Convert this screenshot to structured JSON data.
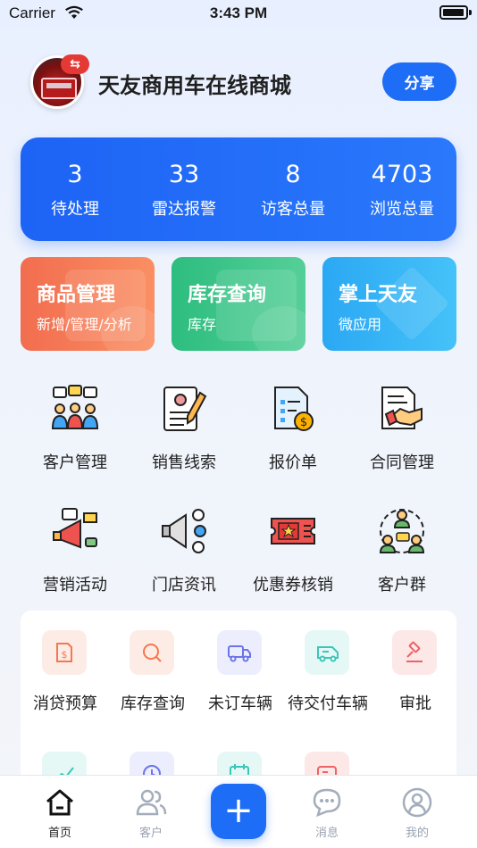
{
  "status_bar": {
    "carrier": "Carrier",
    "time": "3:43 PM",
    "battery_level": 0.95
  },
  "header": {
    "title": "天友商用车在线商城",
    "badge_symbol": "⇆",
    "share_label": "分享"
  },
  "stats": [
    {
      "value": "3",
      "label": "待处理"
    },
    {
      "value": "33",
      "label": "雷达报警"
    },
    {
      "value": "8",
      "label": "访客总量"
    },
    {
      "value": "4703",
      "label": "浏览总量"
    }
  ],
  "feature_cards": [
    {
      "title": "商品管理",
      "subtitle": "新增/管理/分析",
      "color_from": "#f26d4f",
      "color_to": "#fa8f63"
    },
    {
      "title": "库存查询",
      "subtitle": "库存",
      "color_from": "#2dbd7f",
      "color_to": "#55cf98"
    },
    {
      "title": "掌上天友",
      "subtitle": "微应用",
      "color_from": "#2ba8f3",
      "color_to": "#45c2f8"
    }
  ],
  "grid_row1": [
    {
      "label": "客户管理",
      "icon": "customer-group-icon"
    },
    {
      "label": "销售线索",
      "icon": "clipboard-pen-icon"
    },
    {
      "label": "报价单",
      "icon": "quote-document-icon"
    },
    {
      "label": "合同管理",
      "icon": "handshake-contract-icon"
    }
  ],
  "grid_row2": [
    {
      "label": "营销活动",
      "icon": "megaphone-campaign-icon"
    },
    {
      "label": "门店资讯",
      "icon": "loudspeaker-icon"
    },
    {
      "label": "优惠券核销",
      "icon": "coupon-ticket-icon"
    },
    {
      "label": "客户群",
      "icon": "customer-chat-group-icon"
    }
  ],
  "shortcuts": [
    {
      "label": "消贷预算",
      "icon": "loan-budget-icon",
      "color": "#f4774f",
      "bg": "#fdece6"
    },
    {
      "label": "库存查询",
      "icon": "stock-search-icon",
      "color": "#f4774f",
      "bg": "#fdece6"
    },
    {
      "label": "未订车辆",
      "icon": "truck-icon",
      "color": "#6b74e8",
      "bg": "#eceefd"
    },
    {
      "label": "待交付车辆",
      "icon": "delivery-truck-icon",
      "color": "#3cc6b7",
      "bg": "#e5f8f5"
    },
    {
      "label": "审批",
      "icon": "gavel-icon",
      "color": "#ec6266",
      "bg": "#fde8e8"
    }
  ],
  "shortcuts_row2_icons": [
    {
      "icon": "trend-chart-icon",
      "color": "#3cc6b7",
      "bg": "#e5f8f5"
    },
    {
      "icon": "clock-history-icon",
      "color": "#6b74e8",
      "bg": "#eceefd"
    },
    {
      "icon": "calendar-icon",
      "color": "#3cc6b7",
      "bg": "#e5f8f5"
    },
    {
      "icon": "card-icon",
      "color": "#ec6266",
      "bg": "#fde8e8"
    }
  ],
  "tabbar": {
    "items": [
      {
        "label": "首页",
        "icon": "home-icon",
        "active": true
      },
      {
        "label": "客户",
        "icon": "users-icon",
        "active": false
      },
      {
        "label": "消息",
        "icon": "chat-bubble-icon",
        "active": false
      },
      {
        "label": "我的",
        "icon": "profile-icon",
        "active": false
      }
    ],
    "plus_symbol": "+"
  },
  "colors": {
    "primary": "#1e6df6",
    "badge_red": "#e53935"
  }
}
